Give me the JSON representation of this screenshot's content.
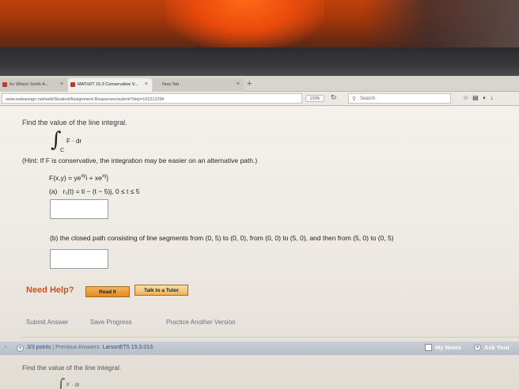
{
  "browser": {
    "tabs": [
      {
        "label": "for Wilson Smith A..."
      },
      {
        "label": "MATH2T 15.3 Conservative V..."
      },
      {
        "label": "New Tab"
      }
    ],
    "url": "www.webassign.net/web/Student/Assignment-Responses/submit?dep=16221229#",
    "zoom": "133%",
    "search_placeholder": "Search"
  },
  "question": {
    "title": "Find the value of the line integral.",
    "integral_sub": "C",
    "integral_body": "F · dr",
    "hint": "(Hint: If F is conservative, the integration may be easier on an alternative path.)",
    "field": "F(x,y) = ye^{xy}i + xe^{xy}j",
    "field_display": "F(x,y) = ye",
    "field_exp1": "xy",
    "field_mid": "i + xe",
    "field_exp2": "xy",
    "field_end": "j",
    "part_a_label": "(a)",
    "part_a_text": "r₁(t) = ti − (t − 5)j, 0 ≤ t ≤ 5",
    "part_a_value": "",
    "part_b_text": "(b) the closed path consisting of line segments from (0, 5) to (0, 0), from (0, 0) to (5, 0), and then from (5, 0) to (0, 5)",
    "part_b_value": ""
  },
  "help": {
    "label": "Need Help?",
    "read_it": "Read It",
    "tutor": "Talk to a Tutor"
  },
  "actions": {
    "submit": "Submit Answer",
    "save": "Save Progress",
    "practice": "Practice Another Version"
  },
  "status_bar": {
    "number": "-",
    "points": "3/3 points",
    "separator": " | ",
    "previous": "Previous Answers",
    "source": "LarsonET5 15.3.013.",
    "notes": "My Notes",
    "ask": "Ask Your"
  },
  "next_question": {
    "title": "Find the value of the line integral.",
    "integral_body": "F · dr"
  },
  "colors": {
    "need_help": "#c9541e",
    "read_it_button": "#e08a1e",
    "status_bar": "#b8bec6"
  }
}
